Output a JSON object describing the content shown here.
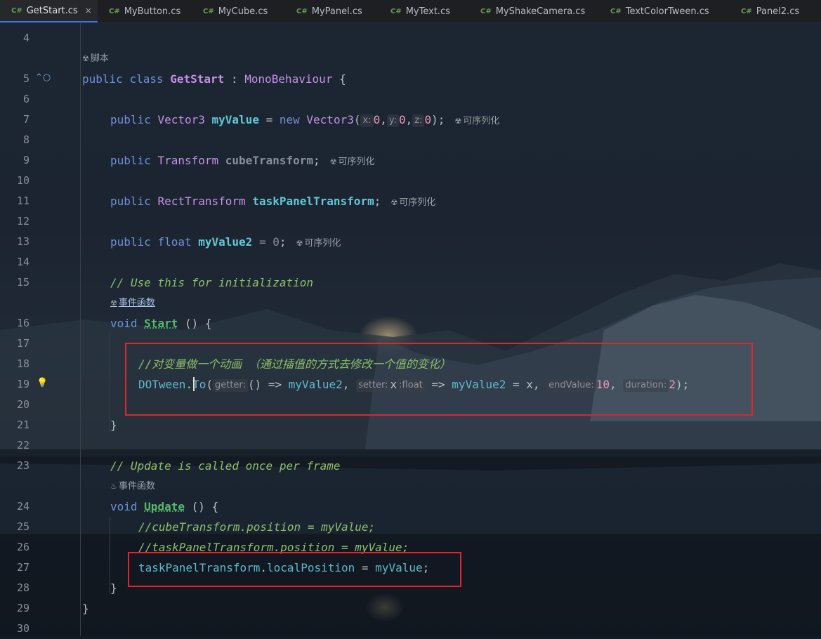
{
  "tabs": [
    {
      "label": "GetStart.cs",
      "badge": "C#",
      "active": true,
      "close": "×"
    },
    {
      "label": "MyButton.cs",
      "badge": "C#"
    },
    {
      "label": "MyCube.cs",
      "badge": "C#"
    },
    {
      "label": "MyPanel.cs",
      "badge": "C#"
    },
    {
      "label": "MyText.cs",
      "badge": "C#"
    },
    {
      "label": "MyShakeCamera.cs",
      "badge": "C#"
    },
    {
      "label": "TextColorTween.cs",
      "badge": "C#"
    },
    {
      "label": "Panel2.cs",
      "badge": "C#"
    }
  ],
  "lines": {
    "l4": "4",
    "l5": "5",
    "l6": "6",
    "l7": "7",
    "l8": "8",
    "l9": "9",
    "l10": "10",
    "l11": "11",
    "l12": "12",
    "l13": "13",
    "l14": "14",
    "l15": "15",
    "l16": "16",
    "l17": "17",
    "l18": "18",
    "l19": "19",
    "l20": "20",
    "l21": "21",
    "l22": "22",
    "l23": "23",
    "l24": "24",
    "l25": "25",
    "l26": "26",
    "l27": "27",
    "l28": "28",
    "l29": "29",
    "l30": "30"
  },
  "lens": {
    "script": "脚本",
    "event1": "事件函数",
    "event2": "事件函数"
  },
  "annotation": "可序列化",
  "code": {
    "public": "public",
    "class": "class",
    "class_name": "GetStart",
    "colon": " : ",
    "base": "MonoBehaviour",
    "brace_open": " {",
    "vector3": "Vector3",
    "myValue": "myValue",
    "eq": " = ",
    "new": "new",
    "x_hint": "x:",
    "y_hint": "y:",
    "z_hint": "z:",
    "zero": "0",
    "transform": "Transform",
    "cubeTransform": "cubeTransform",
    "rectTransform": "RectTransform",
    "taskPanelTransform": "taskPanelTransform",
    "float": "float",
    "myValue2": "myValue2",
    "comment_init": "// Use this for initialization",
    "void": "void",
    "start": "Start",
    "comment_anim": "//对变量做一个动画 （通过插值的方式去修改一个值的变化）",
    "dotween": "DOTween",
    "to": "To",
    "getter_hint": "getter:",
    "setter_hint": "setter:",
    "float_hint": ":float",
    "endValue_hint": "endValue:",
    "duration_hint": "duration:",
    "ten": "10",
    "two": "2",
    "comment_update": "// Update is called once per frame",
    "update": "Update",
    "comment_cube": "//cubeTransform.position = myValue;",
    "comment_panel": "//taskPanelTransform.position = myValue;",
    "localPosition": "localPosition"
  }
}
